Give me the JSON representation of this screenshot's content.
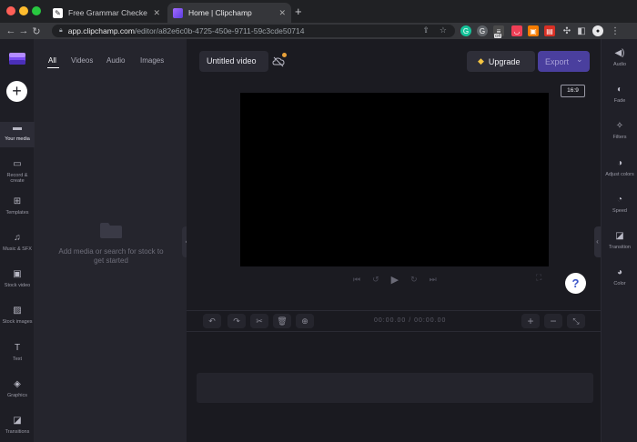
{
  "browser": {
    "tabs": [
      {
        "title": "Free Grammar Checker | Quillb",
        "close": "✕"
      },
      {
        "title": "Home | Clipchamp",
        "close": "✕"
      }
    ],
    "new_tab": "+",
    "url_host": "app.clipchamp.com",
    "url_path": "/editor/a82e6c0b-4725-450e-9711-59c3cde50714",
    "extensions": [
      {
        "name": "grammarly-green-icon",
        "color": "#15c39a",
        "glyph": "G"
      },
      {
        "name": "grammarly-grey-icon",
        "color": "#5f6368",
        "glyph": "G"
      },
      {
        "name": "badge-off-icon",
        "color": "#4a4a4a",
        "glyph": "≡"
      },
      {
        "name": "pocket-icon",
        "color": "#ef3f56",
        "glyph": "◡"
      },
      {
        "name": "orange-ext-icon",
        "color": "#f57c00",
        "glyph": "▣"
      },
      {
        "name": "pdf-ext-icon",
        "color": "#d93025",
        "glyph": "▤"
      },
      {
        "name": "green-ext-icon",
        "color": "#34a853",
        "glyph": "✚"
      }
    ],
    "badge_off": "Off"
  },
  "left_rail": {
    "items": [
      {
        "label": "Your media",
        "icon": "folder-icon"
      },
      {
        "label": "Record & create",
        "icon": "video-record-icon"
      },
      {
        "label": "Templates",
        "icon": "templates-icon"
      },
      {
        "label": "Music & SFX",
        "icon": "music-icon"
      },
      {
        "label": "Stock video",
        "icon": "film-icon"
      },
      {
        "label": "Stock images",
        "icon": "image-icon"
      },
      {
        "label": "Text",
        "icon": "text-icon"
      },
      {
        "label": "Graphics",
        "icon": "shapes-icon"
      },
      {
        "label": "Transitions",
        "icon": "transitions-icon"
      }
    ]
  },
  "media_panel": {
    "tabs": [
      "All",
      "Videos",
      "Audio",
      "Images"
    ],
    "empty_text": "Add media or search for stock to get started"
  },
  "header": {
    "project_title": "Untitled video",
    "upgrade_label": "Upgrade",
    "export_label": "Export",
    "export_chevron": "⌄"
  },
  "preview": {
    "aspect_ratio": "16:9"
  },
  "right_rail": {
    "items": [
      {
        "label": "Audio",
        "icon": "speaker-icon"
      },
      {
        "label": "Fade",
        "icon": "fade-icon"
      },
      {
        "label": "Filters",
        "icon": "magic-wand-icon"
      },
      {
        "label": "Adjust colors",
        "icon": "adjust-colors-icon"
      },
      {
        "label": "Speed",
        "icon": "speedometer-icon"
      },
      {
        "label": "Transition",
        "icon": "transition-icon"
      },
      {
        "label": "Color",
        "icon": "color-palette-icon"
      }
    ]
  },
  "timeline": {
    "timecode_current": "00:00.00",
    "timecode_total": "00:00.00",
    "separator": "/"
  },
  "help": {
    "label": "?"
  }
}
